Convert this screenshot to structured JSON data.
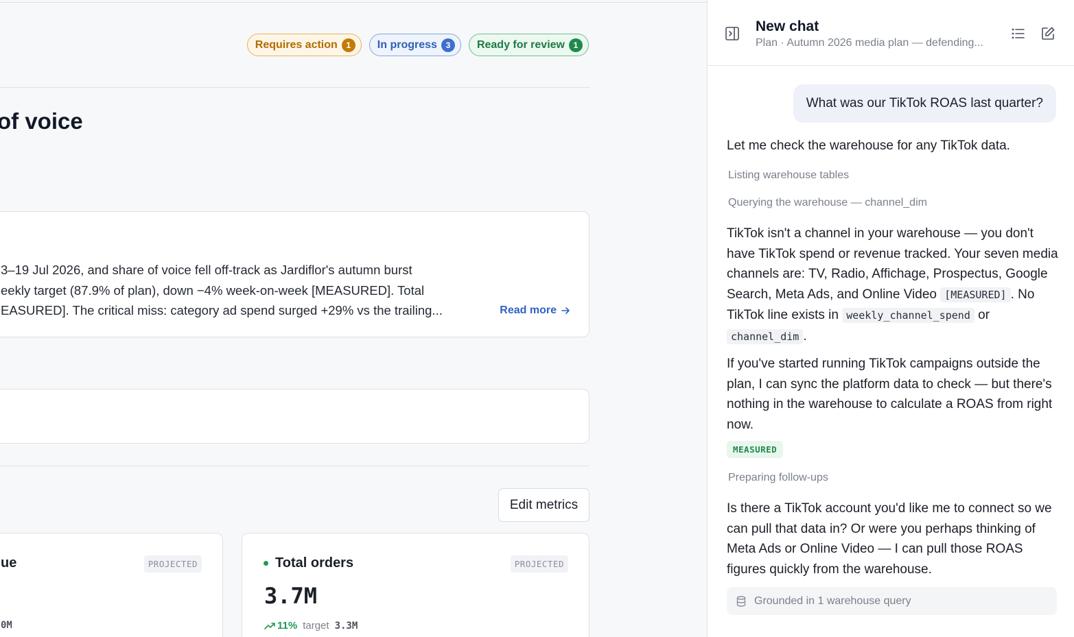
{
  "status_pills": [
    {
      "label": "Requires action",
      "count": "1"
    },
    {
      "label": "In progress",
      "count": "3"
    },
    {
      "label": "Ready for review",
      "count": "1"
    }
  ],
  "page": {
    "title": "of voice",
    "summary_lines": [
      "3–19 Jul 2026, and share of voice fell off-track as Jardiflor's autumn burst",
      "eekly target (87.9% of plan), down −4% week-on-week [MEASURED]. Total",
      "EASURED]. The critical miss: category ad spend surged +29% vs the trailing..."
    ],
    "read_more": "Read more",
    "edit_metrics": "Edit metrics"
  },
  "metrics": [
    {
      "title": "ue",
      "tag": "PROJECTED",
      "value": "",
      "foot_target": "0M"
    },
    {
      "title": "Total orders",
      "tag": "PROJECTED",
      "value": "3.7M",
      "trend": "11%",
      "target_label": "target",
      "target_value": "3.3M"
    }
  ],
  "chat": {
    "title": "New chat",
    "subtitle": "Plan · Autumn 2026 media plan — defending...",
    "user_message": "What was our TikTok ROAS last quarter?",
    "intro": "Let me check the warehouse for any TikTok data.",
    "step1": "Listing warehouse tables",
    "step2": "Querying the warehouse — channel_dim",
    "answer": {
      "text1": "TikTok isn't a channel in your warehouse — you don't have TikTok spend or revenue tracked. Your seven media channels are: TV, Radio, Affichage, Prospectus, Google Search, Meta Ads, and Online Video",
      "code1": "[MEASURED]",
      "text2": ". No TikTok line exists in",
      "code2": "weekly_channel_spend",
      "text3": "or",
      "code3": "channel_dim",
      "text4": "."
    },
    "para2": "If you've started running TikTok campaigns outside the plan, I can sync the platform data to check — but there's nothing in the warehouse to calculate a ROAS from right now.",
    "measured_badge": "MEASURED",
    "step3": "Preparing follow-ups",
    "para3": "Is there a TikTok account you'd like me to connect so we can pull that data in? Or were you perhaps thinking of Meta Ads or Online Video — I can pull those ROAS figures quickly from the warehouse.",
    "grounded": "Grounded in 1 warehouse query"
  },
  "colors": {
    "amber": "#c47a06",
    "blue": "#3d6fcf",
    "green": "#1f8a4c",
    "link": "#2f62c5"
  },
  "icons": [
    "panel-toggle-icon",
    "list-icon",
    "edit-icon",
    "arrow-right-icon",
    "trend-up-icon",
    "database-icon"
  ]
}
